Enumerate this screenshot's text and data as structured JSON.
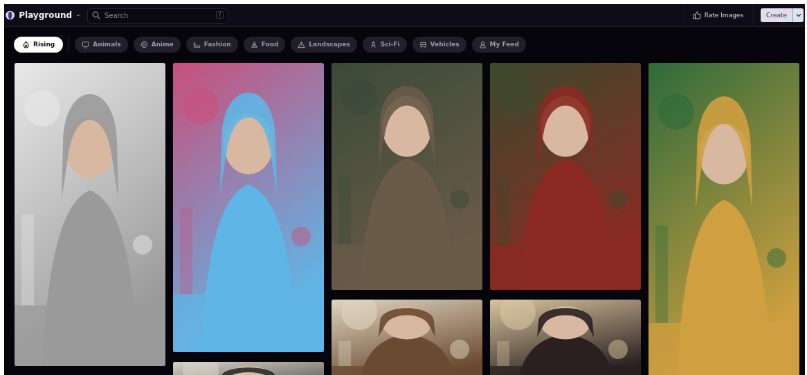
{
  "header": {
    "brand": "Playground",
    "search": {
      "placeholder": "Search",
      "shortcut": "/"
    },
    "rate_button": "Rate Images",
    "create_button": "Create"
  },
  "filters": [
    {
      "label": "Rising",
      "selected": true
    },
    {
      "label": "Animals",
      "selected": false
    },
    {
      "label": "Anime",
      "selected": false
    },
    {
      "label": "Fashion",
      "selected": false
    },
    {
      "label": "Food",
      "selected": false
    },
    {
      "label": "Landscapes",
      "selected": false
    },
    {
      "label": "Sci-Fi",
      "selected": false
    },
    {
      "label": "Vehicles",
      "selected": false
    },
    {
      "label": "My Feed",
      "selected": false
    }
  ]
}
